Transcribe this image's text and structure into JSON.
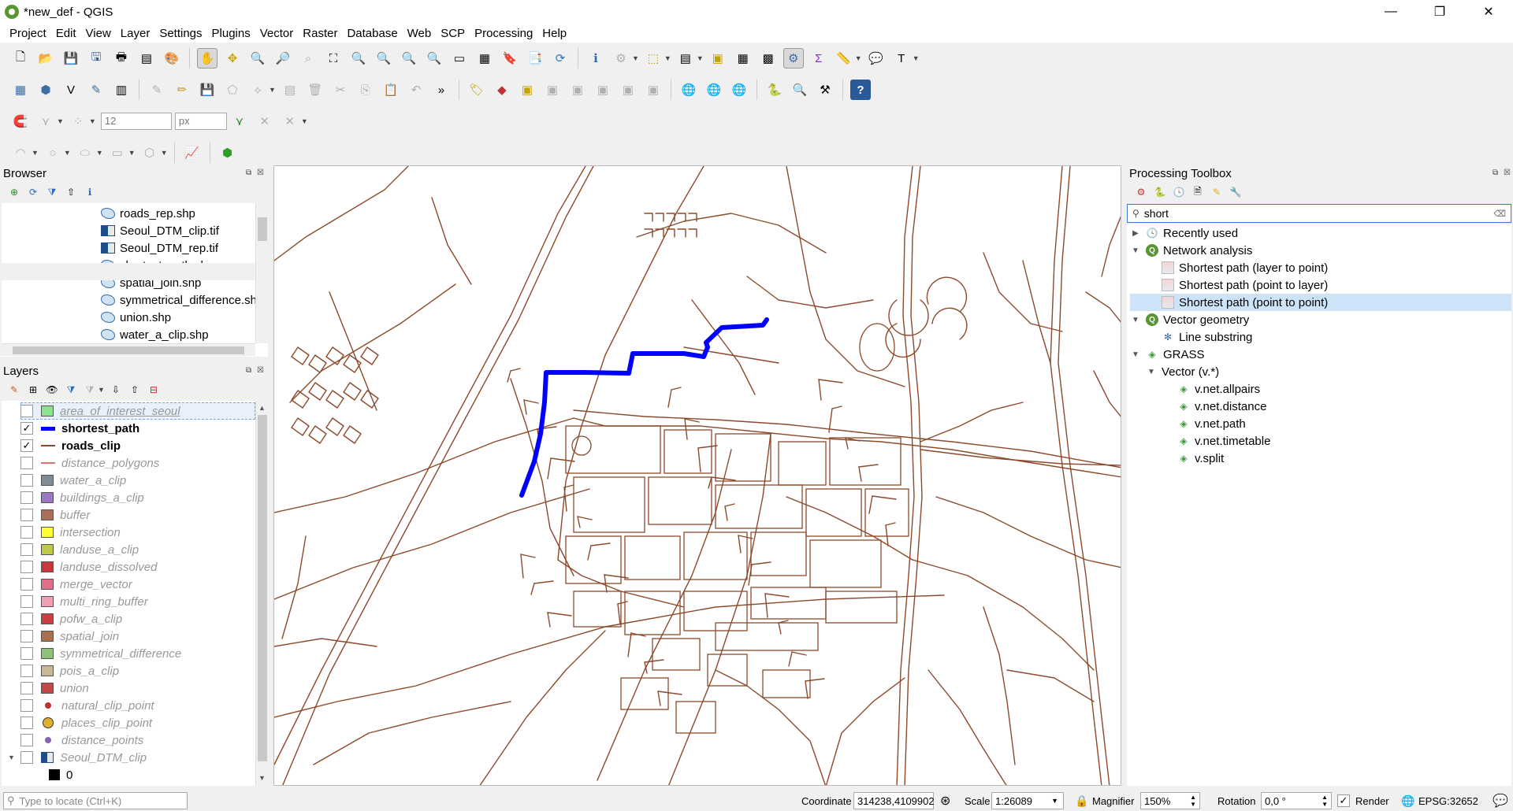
{
  "window": {
    "title": "*new_def - QGIS",
    "controls": [
      "—",
      "❐",
      "✕"
    ]
  },
  "menu": [
    "Project",
    "Edit",
    "View",
    "Layer",
    "Settings",
    "Plugins",
    "Vector",
    "Raster",
    "Database",
    "Web",
    "SCP",
    "Processing",
    "Help"
  ],
  "toolbar": {
    "snap_size": "12",
    "snap_unit": "px",
    "more": "»"
  },
  "browser": {
    "title": "Browser",
    "items": [
      {
        "label": "roads_rep.shp",
        "type": "vector"
      },
      {
        "label": "Seoul_DTM_clip.tif",
        "type": "raster"
      },
      {
        "label": "Seoul_DTM_rep.tif",
        "type": "raster"
      },
      {
        "label": "shortest_path.shp",
        "type": "vector"
      },
      {
        "label": "spatial_join.shp",
        "type": "vector"
      },
      {
        "label": "symmetrical_difference.sh",
        "type": "vector"
      },
      {
        "label": "union.shp",
        "type": "vector"
      },
      {
        "label": "water_a_clip.shp",
        "type": "vector"
      }
    ]
  },
  "layers": {
    "title": "Layers",
    "items": [
      {
        "label": "area_of_interest_seoul",
        "checked": false,
        "color": "#8fe08f",
        "kind": "poly"
      },
      {
        "label": "shortest_path",
        "checked": true,
        "color": "#0000ff",
        "kind": "thickline"
      },
      {
        "label": "roads_clip",
        "checked": true,
        "color": "#8b4a2b",
        "kind": "line"
      },
      {
        "label": "distance_polygons",
        "checked": false,
        "color": "#e07070",
        "kind": "line"
      },
      {
        "label": "water_a_clip",
        "checked": false,
        "color": "#7d8c96",
        "kind": "poly"
      },
      {
        "label": "buildings_a_clip",
        "checked": false,
        "color": "#9b79c2",
        "kind": "poly"
      },
      {
        "label": "buffer",
        "checked": false,
        "color": "#a8705a",
        "kind": "poly"
      },
      {
        "label": "intersection",
        "checked": false,
        "color": "#ffff33",
        "kind": "poly"
      },
      {
        "label": "landuse_a_clip",
        "checked": false,
        "color": "#bcc94a",
        "kind": "poly"
      },
      {
        "label": "landuse_dissolved",
        "checked": false,
        "color": "#c83a3a",
        "kind": "poly"
      },
      {
        "label": "merge_vector",
        "checked": false,
        "color": "#e0708a",
        "kind": "poly"
      },
      {
        "label": "multi_ring_buffer",
        "checked": false,
        "color": "#f0a0b0",
        "kind": "poly"
      },
      {
        "label": "pofw_a_clip",
        "checked": false,
        "color": "#c84040",
        "kind": "poly"
      },
      {
        "label": "spatial_join",
        "checked": false,
        "color": "#a87050",
        "kind": "poly"
      },
      {
        "label": "symmetrical_difference",
        "checked": false,
        "color": "#8fc07a",
        "kind": "poly"
      },
      {
        "label": "pois_a_clip",
        "checked": false,
        "color": "#c8b898",
        "kind": "poly"
      },
      {
        "label": "union",
        "checked": false,
        "color": "#c04848",
        "kind": "poly"
      },
      {
        "label": "natural_clip_point",
        "checked": false,
        "color": "#c03030",
        "kind": "dot"
      },
      {
        "label": "places_clip_point",
        "checked": false,
        "color": "#e0b030",
        "kind": "bigdot"
      },
      {
        "label": "distance_points",
        "checked": false,
        "color": "#8a60b0",
        "kind": "dot"
      },
      {
        "label": "Seoul_DTM_clip",
        "checked": false,
        "color": "#1d4e89",
        "kind": "raster"
      },
      {
        "label": "0",
        "checked": null,
        "color": "#000000",
        "kind": "legend"
      }
    ]
  },
  "toolbox": {
    "title": "Processing Toolbox",
    "search": "short",
    "tree": [
      {
        "label": "Recently used",
        "level": 0,
        "arrow": "▶",
        "icon": "clock"
      },
      {
        "label": "Network analysis",
        "level": 0,
        "arrow": "▼",
        "icon": "qgis"
      },
      {
        "label": "Shortest path (layer to point)",
        "level": 1,
        "arrow": "",
        "icon": "path"
      },
      {
        "label": "Shortest path (point to layer)",
        "level": 1,
        "arrow": "",
        "icon": "path"
      },
      {
        "label": "Shortest path (point to point)",
        "level": 1,
        "arrow": "",
        "icon": "path",
        "selected": true
      },
      {
        "label": "Vector geometry",
        "level": 0,
        "arrow": "▼",
        "icon": "qgis"
      },
      {
        "label": "Line substring",
        "level": 1,
        "arrow": "",
        "icon": "gear"
      },
      {
        "label": "GRASS",
        "level": 0,
        "arrow": "▼",
        "icon": "grass"
      },
      {
        "label": "Vector (v.*)",
        "level": 1,
        "arrow": "▼",
        "icon": ""
      },
      {
        "label": "v.net.allpairs",
        "level": 2,
        "arrow": "",
        "icon": "grass"
      },
      {
        "label": "v.net.distance",
        "level": 2,
        "arrow": "",
        "icon": "grass"
      },
      {
        "label": "v.net.path",
        "level": 2,
        "arrow": "",
        "icon": "grass"
      },
      {
        "label": "v.net.timetable",
        "level": 2,
        "arrow": "",
        "icon": "grass"
      },
      {
        "label": "v.split",
        "level": 2,
        "arrow": "",
        "icon": "grass"
      }
    ]
  },
  "status": {
    "locate_placeholder": "Type to locate (Ctrl+K)",
    "coordinate_label": "Coordinate",
    "coordinate": "314238,4109902",
    "scale_label": "Scale",
    "scale": "1:26089",
    "magnifier_label": "Magnifier",
    "magnifier": "150%",
    "rotation_label": "Rotation",
    "rotation": "0,0 °",
    "render_label": "Render",
    "crs": "EPSG:32652"
  },
  "colors": {
    "road": "#8b4a2b",
    "path": "#0000ff",
    "selection": "#cde3f7"
  }
}
